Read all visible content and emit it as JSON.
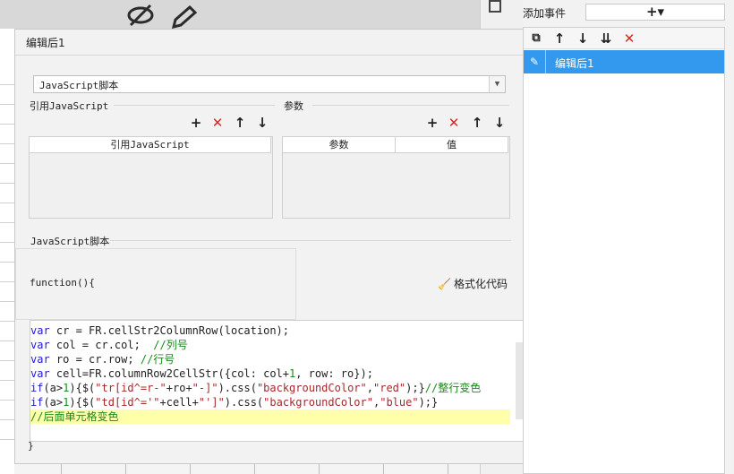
{
  "dialog": {
    "title": "编辑后1",
    "type_select": "JavaScript脚本",
    "ref_section": "引用JavaScript",
    "param_section": "参数",
    "ref_table": {
      "columns": [
        "引用JavaScript"
      ]
    },
    "param_table": {
      "columns": [
        "参数",
        "值"
      ]
    },
    "script_section": "JavaScript脚本",
    "function_open": "function(){",
    "format_button": "格式化代码",
    "function_close": "}"
  },
  "code": {
    "line1": {
      "kw": "var",
      "rest": " cr = FR.cellStr2ColumnRow(location);"
    },
    "line2": {
      "kw": "var",
      "rest": " col = cr.col;  ",
      "comment": "//列号"
    },
    "line3": {
      "kw": "var",
      "rest": " ro = cr.row; ",
      "comment": "//行号"
    },
    "line4": {
      "kw": "var",
      "rest1": " cell=FR.columnRow2CellStr({col: col+",
      "num1": "1",
      "rest2": ", row: ro});"
    },
    "line5": {
      "kw": "if",
      "p1": "(a>",
      "num": "1",
      "p2": "){$(",
      "s1": "\"tr[id^=r-\"",
      "p3": "+ro+",
      "s2": "\"-]\"",
      "p4": ").css(",
      "s3": "\"backgroundColor\"",
      "p5": ",",
      "s4": "\"red\"",
      "p6": ");}",
      "comment": "//整行变色"
    },
    "line6": {
      "kw": "if",
      "p1": "(a>",
      "num": "1",
      "p2": "){$(",
      "s1": "\"td[id^='\"",
      "p3": "+cell+",
      "s2": "\"']\"",
      "p4": ").css(",
      "s3": "\"backgroundColor\"",
      "p5": ",",
      "s4": "\"blue\"",
      "p6": ");}"
    },
    "line7": {
      "comment": "//后面单元格变色"
    }
  },
  "right_panel": {
    "title": "添加事件",
    "add_symbol": "+▾",
    "events": [
      {
        "label": "编辑后1"
      }
    ]
  },
  "icons": {
    "hidden": "eye-slash-icon",
    "edit": "pencil-icon",
    "window": "window-icon",
    "add": "plus-icon",
    "delete": "x-icon",
    "up": "arrow-up-icon",
    "down": "arrow-down-icon",
    "copy": "copy-icon",
    "sort": "sort-down-icon",
    "format": "broom-icon"
  },
  "colors": {
    "selection": "#3399ee",
    "delete": "#e02424",
    "keyword": "#2020d0",
    "comment": "#1b8a1b",
    "string": "#a52a2a",
    "highlight": "#ffffaa"
  }
}
